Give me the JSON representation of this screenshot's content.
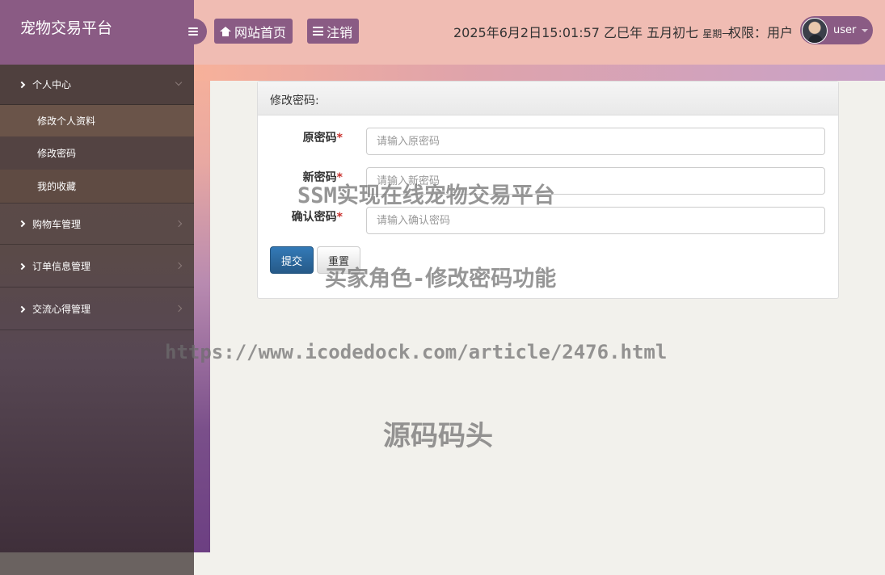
{
  "header": {
    "brand": "宠物交易平台",
    "home_label": "网站首页",
    "logout_label": "注销",
    "datetime": "2025年6月2日15:01:57 乙巳年 五月初七",
    "weekday": "星期一",
    "role": "权限：用户",
    "username": "user"
  },
  "sidebar": {
    "groups": [
      {
        "label": "个人中心",
        "expanded": true,
        "items": [
          {
            "label": "修改个人资料"
          },
          {
            "label": "修改密码"
          },
          {
            "label": "我的收藏"
          }
        ]
      },
      {
        "label": "购物车管理",
        "expanded": false
      },
      {
        "label": "订单信息管理",
        "expanded": false
      },
      {
        "label": "交流心得管理",
        "expanded": false
      }
    ]
  },
  "form": {
    "title": "修改密码:",
    "fields": [
      {
        "label": "原密码",
        "placeholder": "请输入原密码"
      },
      {
        "label": "新密码",
        "placeholder": "请输入新密码"
      },
      {
        "label": "确认密码",
        "placeholder": "请输入确认密码"
      }
    ],
    "submit_label": "提交",
    "reset_label": "重置"
  },
  "watermarks": {
    "line1": "SSM实现在线宠物交易平台",
    "line2": "买家角色-修改密码功能",
    "line3": "https://www.icodedock.com/article/2476.html",
    "line4": "源码码头"
  },
  "icons": {
    "menu_toggle": "bars-icon",
    "home": "home-icon",
    "logout": "list-icon"
  }
}
